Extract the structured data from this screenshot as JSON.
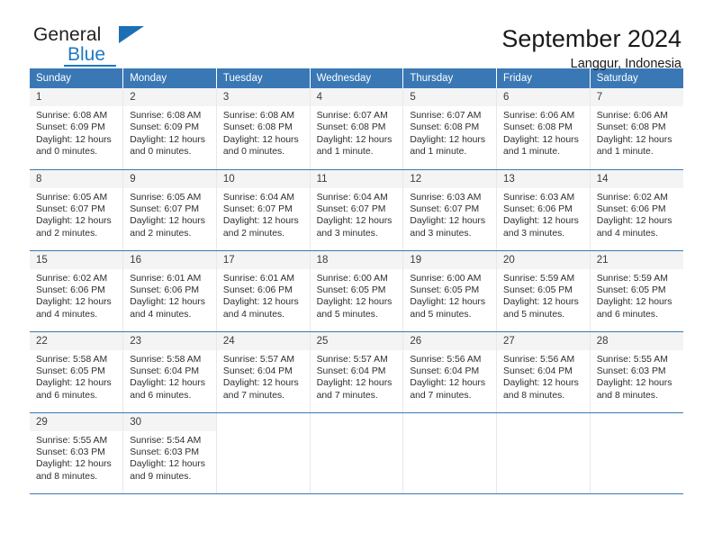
{
  "logo": {
    "line1": "General",
    "line2": "Blue",
    "flag_icon": "triangle-flag-icon"
  },
  "header": {
    "title": "September 2024",
    "subtitle": "Langgur, Indonesia"
  },
  "colors": {
    "header_blue": "#3a78b5",
    "logo_blue": "#1f78c1",
    "daynum_band": "#f4f4f4",
    "row_rule": "#3a78b5"
  },
  "weekday_headers": [
    "Sunday",
    "Monday",
    "Tuesday",
    "Wednesday",
    "Thursday",
    "Friday",
    "Saturday"
  ],
  "weeks": [
    [
      {
        "day": "1",
        "sunrise": "Sunrise: 6:08 AM",
        "sunset": "Sunset: 6:09 PM",
        "daylight_1": "Daylight: 12 hours",
        "daylight_2": "and 0 minutes."
      },
      {
        "day": "2",
        "sunrise": "Sunrise: 6:08 AM",
        "sunset": "Sunset: 6:09 PM",
        "daylight_1": "Daylight: 12 hours",
        "daylight_2": "and 0 minutes."
      },
      {
        "day": "3",
        "sunrise": "Sunrise: 6:08 AM",
        "sunset": "Sunset: 6:08 PM",
        "daylight_1": "Daylight: 12 hours",
        "daylight_2": "and 0 minutes."
      },
      {
        "day": "4",
        "sunrise": "Sunrise: 6:07 AM",
        "sunset": "Sunset: 6:08 PM",
        "daylight_1": "Daylight: 12 hours",
        "daylight_2": "and 1 minute."
      },
      {
        "day": "5",
        "sunrise": "Sunrise: 6:07 AM",
        "sunset": "Sunset: 6:08 PM",
        "daylight_1": "Daylight: 12 hours",
        "daylight_2": "and 1 minute."
      },
      {
        "day": "6",
        "sunrise": "Sunrise: 6:06 AM",
        "sunset": "Sunset: 6:08 PM",
        "daylight_1": "Daylight: 12 hours",
        "daylight_2": "and 1 minute."
      },
      {
        "day": "7",
        "sunrise": "Sunrise: 6:06 AM",
        "sunset": "Sunset: 6:08 PM",
        "daylight_1": "Daylight: 12 hours",
        "daylight_2": "and 1 minute."
      }
    ],
    [
      {
        "day": "8",
        "sunrise": "Sunrise: 6:05 AM",
        "sunset": "Sunset: 6:07 PM",
        "daylight_1": "Daylight: 12 hours",
        "daylight_2": "and 2 minutes."
      },
      {
        "day": "9",
        "sunrise": "Sunrise: 6:05 AM",
        "sunset": "Sunset: 6:07 PM",
        "daylight_1": "Daylight: 12 hours",
        "daylight_2": "and 2 minutes."
      },
      {
        "day": "10",
        "sunrise": "Sunrise: 6:04 AM",
        "sunset": "Sunset: 6:07 PM",
        "daylight_1": "Daylight: 12 hours",
        "daylight_2": "and 2 minutes."
      },
      {
        "day": "11",
        "sunrise": "Sunrise: 6:04 AM",
        "sunset": "Sunset: 6:07 PM",
        "daylight_1": "Daylight: 12 hours",
        "daylight_2": "and 3 minutes."
      },
      {
        "day": "12",
        "sunrise": "Sunrise: 6:03 AM",
        "sunset": "Sunset: 6:07 PM",
        "daylight_1": "Daylight: 12 hours",
        "daylight_2": "and 3 minutes."
      },
      {
        "day": "13",
        "sunrise": "Sunrise: 6:03 AM",
        "sunset": "Sunset: 6:06 PM",
        "daylight_1": "Daylight: 12 hours",
        "daylight_2": "and 3 minutes."
      },
      {
        "day": "14",
        "sunrise": "Sunrise: 6:02 AM",
        "sunset": "Sunset: 6:06 PM",
        "daylight_1": "Daylight: 12 hours",
        "daylight_2": "and 4 minutes."
      }
    ],
    [
      {
        "day": "15",
        "sunrise": "Sunrise: 6:02 AM",
        "sunset": "Sunset: 6:06 PM",
        "daylight_1": "Daylight: 12 hours",
        "daylight_2": "and 4 minutes."
      },
      {
        "day": "16",
        "sunrise": "Sunrise: 6:01 AM",
        "sunset": "Sunset: 6:06 PM",
        "daylight_1": "Daylight: 12 hours",
        "daylight_2": "and 4 minutes."
      },
      {
        "day": "17",
        "sunrise": "Sunrise: 6:01 AM",
        "sunset": "Sunset: 6:06 PM",
        "daylight_1": "Daylight: 12 hours",
        "daylight_2": "and 4 minutes."
      },
      {
        "day": "18",
        "sunrise": "Sunrise: 6:00 AM",
        "sunset": "Sunset: 6:05 PM",
        "daylight_1": "Daylight: 12 hours",
        "daylight_2": "and 5 minutes."
      },
      {
        "day": "19",
        "sunrise": "Sunrise: 6:00 AM",
        "sunset": "Sunset: 6:05 PM",
        "daylight_1": "Daylight: 12 hours",
        "daylight_2": "and 5 minutes."
      },
      {
        "day": "20",
        "sunrise": "Sunrise: 5:59 AM",
        "sunset": "Sunset: 6:05 PM",
        "daylight_1": "Daylight: 12 hours",
        "daylight_2": "and 5 minutes."
      },
      {
        "day": "21",
        "sunrise": "Sunrise: 5:59 AM",
        "sunset": "Sunset: 6:05 PM",
        "daylight_1": "Daylight: 12 hours",
        "daylight_2": "and 6 minutes."
      }
    ],
    [
      {
        "day": "22",
        "sunrise": "Sunrise: 5:58 AM",
        "sunset": "Sunset: 6:05 PM",
        "daylight_1": "Daylight: 12 hours",
        "daylight_2": "and 6 minutes."
      },
      {
        "day": "23",
        "sunrise": "Sunrise: 5:58 AM",
        "sunset": "Sunset: 6:04 PM",
        "daylight_1": "Daylight: 12 hours",
        "daylight_2": "and 6 minutes."
      },
      {
        "day": "24",
        "sunrise": "Sunrise: 5:57 AM",
        "sunset": "Sunset: 6:04 PM",
        "daylight_1": "Daylight: 12 hours",
        "daylight_2": "and 7 minutes."
      },
      {
        "day": "25",
        "sunrise": "Sunrise: 5:57 AM",
        "sunset": "Sunset: 6:04 PM",
        "daylight_1": "Daylight: 12 hours",
        "daylight_2": "and 7 minutes."
      },
      {
        "day": "26",
        "sunrise": "Sunrise: 5:56 AM",
        "sunset": "Sunset: 6:04 PM",
        "daylight_1": "Daylight: 12 hours",
        "daylight_2": "and 7 minutes."
      },
      {
        "day": "27",
        "sunrise": "Sunrise: 5:56 AM",
        "sunset": "Sunset: 6:04 PM",
        "daylight_1": "Daylight: 12 hours",
        "daylight_2": "and 8 minutes."
      },
      {
        "day": "28",
        "sunrise": "Sunrise: 5:55 AM",
        "sunset": "Sunset: 6:03 PM",
        "daylight_1": "Daylight: 12 hours",
        "daylight_2": "and 8 minutes."
      }
    ],
    [
      {
        "day": "29",
        "sunrise": "Sunrise: 5:55 AM",
        "sunset": "Sunset: 6:03 PM",
        "daylight_1": "Daylight: 12 hours",
        "daylight_2": "and 8 minutes."
      },
      {
        "day": "30",
        "sunrise": "Sunrise: 5:54 AM",
        "sunset": "Sunset: 6:03 PM",
        "daylight_1": "Daylight: 12 hours",
        "daylight_2": "and 9 minutes."
      },
      {
        "day": "",
        "sunrise": "",
        "sunset": "",
        "daylight_1": "",
        "daylight_2": ""
      },
      {
        "day": "",
        "sunrise": "",
        "sunset": "",
        "daylight_1": "",
        "daylight_2": ""
      },
      {
        "day": "",
        "sunrise": "",
        "sunset": "",
        "daylight_1": "",
        "daylight_2": ""
      },
      {
        "day": "",
        "sunrise": "",
        "sunset": "",
        "daylight_1": "",
        "daylight_2": ""
      },
      {
        "day": "",
        "sunrise": "",
        "sunset": "",
        "daylight_1": "",
        "daylight_2": ""
      }
    ]
  ]
}
